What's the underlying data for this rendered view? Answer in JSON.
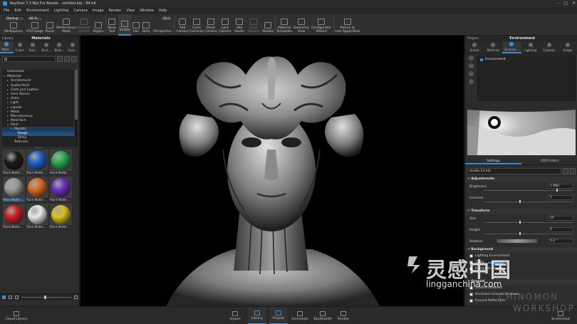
{
  "window": {
    "title": "KeyShot 7.3 Not For Resale - untitled.bip - 64 bit",
    "controls": [
      "–",
      "□",
      "✕"
    ]
  },
  "menu": [
    "File",
    "Edit",
    "Environment",
    "Lighting",
    "Camera",
    "Image",
    "Render",
    "View",
    "Window",
    "Help"
  ],
  "toolbar": {
    "workspace_select": "Startup",
    "cpu_field": "66 %",
    "perspective_field": "50.2",
    "tools": [
      {
        "label": "Workspaces",
        "icon": "workspaces-icon"
      },
      {
        "label": "CPU Usage",
        "icon": "cpu-icon"
      },
      {
        "label": "Pause",
        "icon": "pause-icon"
      },
      {
        "label": "Performance\nMode",
        "icon": "performance-icon"
      },
      {
        "label": "Denoise\nUpdate",
        "icon": "denoise-icon"
      },
      {
        "label": "Region",
        "icon": "region-icon"
      },
      {
        "label": "Move\nTool",
        "icon": "move-icon"
      },
      {
        "label": "Tumble",
        "icon": "tumble-icon"
      },
      {
        "label": "Pan",
        "icon": "pan-icon"
      },
      {
        "label": "Dolly",
        "icon": "dolly-icon"
      },
      {
        "label": "Perspective",
        "icon": "perspective-icon"
      },
      {
        "label": "Add\nCamera",
        "icon": "add-camera-icon"
      },
      {
        "label": "Cycle\nCameras",
        "icon": "cycle-cameras-icon"
      },
      {
        "label": "Reset\nCamera",
        "icon": "reset-camera-icon"
      },
      {
        "label": "Lock\nCamera",
        "icon": "lock-camera-icon"
      },
      {
        "label": "Add\nStudio",
        "icon": "add-studio-icon"
      },
      {
        "label": "Cycle\nStudios",
        "icon": "cycle-studios-icon"
      },
      {
        "label": "Studios",
        "icon": "studios-icon"
      },
      {
        "label": "Material\nTemplates",
        "icon": "material-templates-icon"
      },
      {
        "label": "Geometry\nView",
        "icon": "geometry-view-icon"
      },
      {
        "label": "Configurator\nWizard",
        "icon": "configurator-icon"
      },
      {
        "label": "Return to\nLink Application",
        "icon": "return-link-icon"
      }
    ]
  },
  "library": {
    "header_left": "Library",
    "header_title": "Materials",
    "tabs": [
      "Mate...",
      "Colors",
      "Text...",
      "Envi...",
      "Back...",
      "Favo..."
    ],
    "tree": [
      {
        "label": "Downloads",
        "depth": 0,
        "arrow": ""
      },
      {
        "label": "Materials",
        "depth": 0,
        "arrow": "▾"
      },
      {
        "label": "Architectural",
        "depth": 1,
        "arrow": "▸"
      },
      {
        "label": "Axalta Paint",
        "depth": 1,
        "arrow": "▸"
      },
      {
        "label": "Cloth and Leather",
        "depth": 1,
        "arrow": "▸"
      },
      {
        "label": "Gem Stones",
        "depth": 1,
        "arrow": "▸"
      },
      {
        "label": "Glass",
        "depth": 1,
        "arrow": "▸"
      },
      {
        "label": "Light",
        "depth": 1,
        "arrow": "▸"
      },
      {
        "label": "Liquids",
        "depth": 1,
        "arrow": "▸"
      },
      {
        "label": "Metal",
        "depth": 1,
        "arrow": "▸"
      },
      {
        "label": "Miscellaneous",
        "depth": 1,
        "arrow": "▸"
      },
      {
        "label": "Mold-Tech",
        "depth": 1,
        "arrow": "▸"
      },
      {
        "label": "Paint",
        "depth": 1,
        "arrow": "▾"
      },
      {
        "label": "Metallic",
        "depth": 2,
        "arrow": "▾"
      },
      {
        "label": "Rough",
        "depth": 3,
        "arrow": ""
      },
      {
        "label": "Shiny",
        "depth": 3,
        "arrow": ""
      },
      {
        "label": "Textured",
        "depth": 2,
        "arrow": ""
      }
    ],
    "thumbnails": [
      {
        "caption": "Paint Matte ...",
        "color": "#1a1a1a"
      },
      {
        "caption": "Paint Matte ...",
        "color": "#1f5fc8"
      },
      {
        "caption": "Paint Matte ...",
        "color": "#2aa84a"
      },
      {
        "caption": "Paint Matte ...",
        "color": "#9a9a9a"
      },
      {
        "caption": "Paint Matte ...",
        "color": "#d8691e"
      },
      {
        "caption": "Paint Matte ...",
        "color": "#6a2fc0"
      },
      {
        "caption": "Paint Matte ...",
        "color": "#c81f1f"
      },
      {
        "caption": "Paint Matte ...",
        "color": "#e8e8e8"
      },
      {
        "caption": "Paint Matte ...",
        "color": "#d8c21a"
      }
    ]
  },
  "project": {
    "header_left": "Project",
    "header_title": "Environment",
    "tabs": [
      "Scene",
      "Material",
      "Environ...",
      "Lighting",
      "Camera",
      "Image"
    ],
    "env_item": "Environment",
    "settings_tabs": [
      "Settings",
      "HDRI Editor"
    ],
    "hdri_file": "studio-12.hdr",
    "sections": {
      "adjustments": "Adjustments",
      "transform": "Transform",
      "background": "Background",
      "ground": "Ground"
    },
    "props": {
      "brightness_label": "Brightness",
      "brightness_value": "1.940",
      "contrast_label": "Contrast",
      "contrast_value": "1",
      "size_label": "Size",
      "size_value": "25",
      "height_label": "Height",
      "height_value": "0",
      "rotation_label": "Rotation",
      "rotation_value": "6.2 °"
    },
    "background_items": {
      "lighting_env": "Lighting Environment",
      "color": "Color",
      "backplate": "Backplate Image"
    },
    "ground_items": [
      "Ground Shadows",
      "Occlusion Ground Shadows",
      "Ground Reflections"
    ],
    "bg_color": "#1c6bb8"
  },
  "bottom": {
    "cloud_library": "Cloud Library",
    "items": [
      "Import",
      "Library",
      "Project",
      "Animation",
      "KeyShotXR",
      "Render"
    ],
    "screenshot": "Screenshot"
  },
  "watermark": {
    "cn": "灵感中国",
    "url": "lingganchina.com",
    "brand1": "CHINOMON",
    "brand2": "WORKSHOP"
  }
}
